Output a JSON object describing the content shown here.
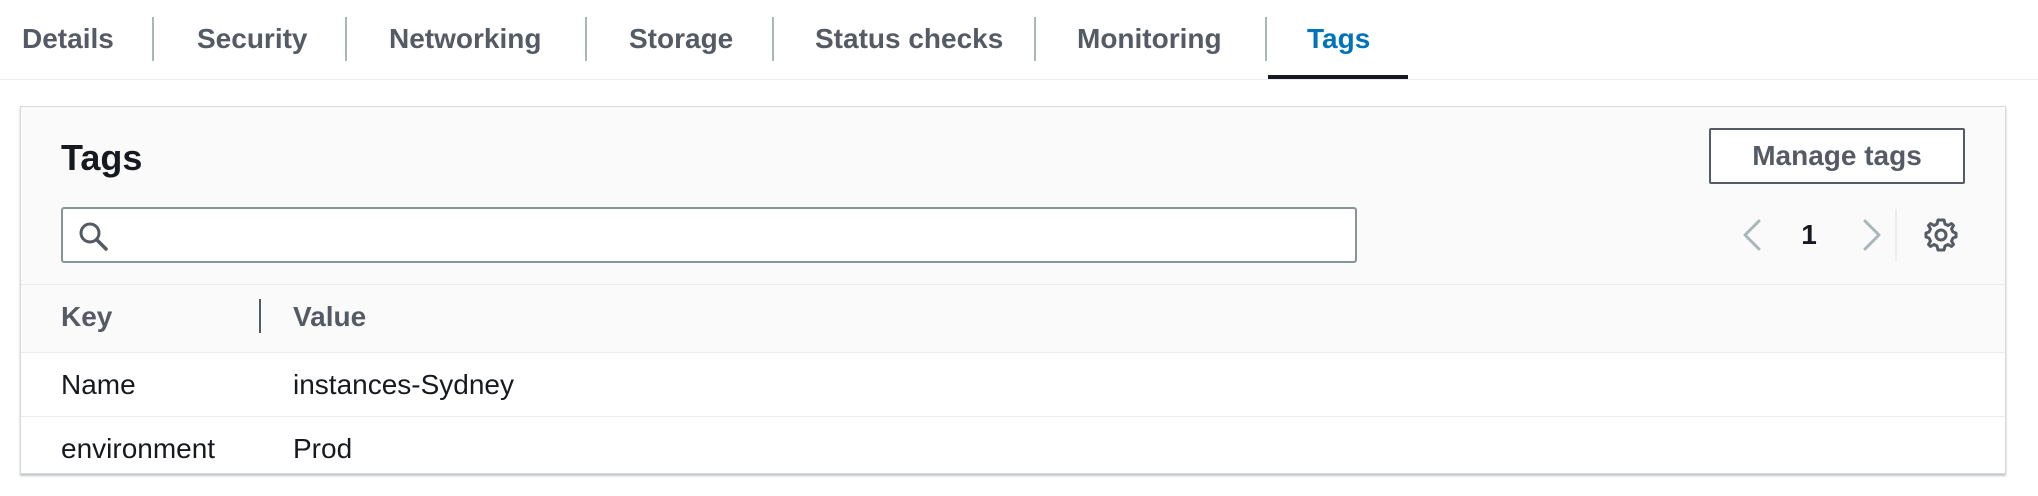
{
  "tabs": [
    {
      "label": "Details"
    },
    {
      "label": "Security"
    },
    {
      "label": "Networking"
    },
    {
      "label": "Storage"
    },
    {
      "label": "Status checks"
    },
    {
      "label": "Monitoring"
    },
    {
      "label": "Tags"
    }
  ],
  "active_tab": "Tags",
  "panel": {
    "title": "Tags",
    "manage_button_label": "Manage tags",
    "search": {
      "value": "",
      "placeholder": ""
    },
    "pagination": {
      "current_page": "1"
    }
  },
  "table": {
    "columns": [
      "Key",
      "Value"
    ],
    "rows": [
      {
        "key": "Name",
        "value": "instances-Sydney"
      },
      {
        "key": "environment",
        "value": "Prod"
      }
    ]
  },
  "colors": {
    "active_tab": "#0073bb",
    "tab_text": "#545b64",
    "underline": "#16191f"
  },
  "icons": [
    "search-icon",
    "chevron-left-icon",
    "chevron-right-icon",
    "gear-icon"
  ]
}
